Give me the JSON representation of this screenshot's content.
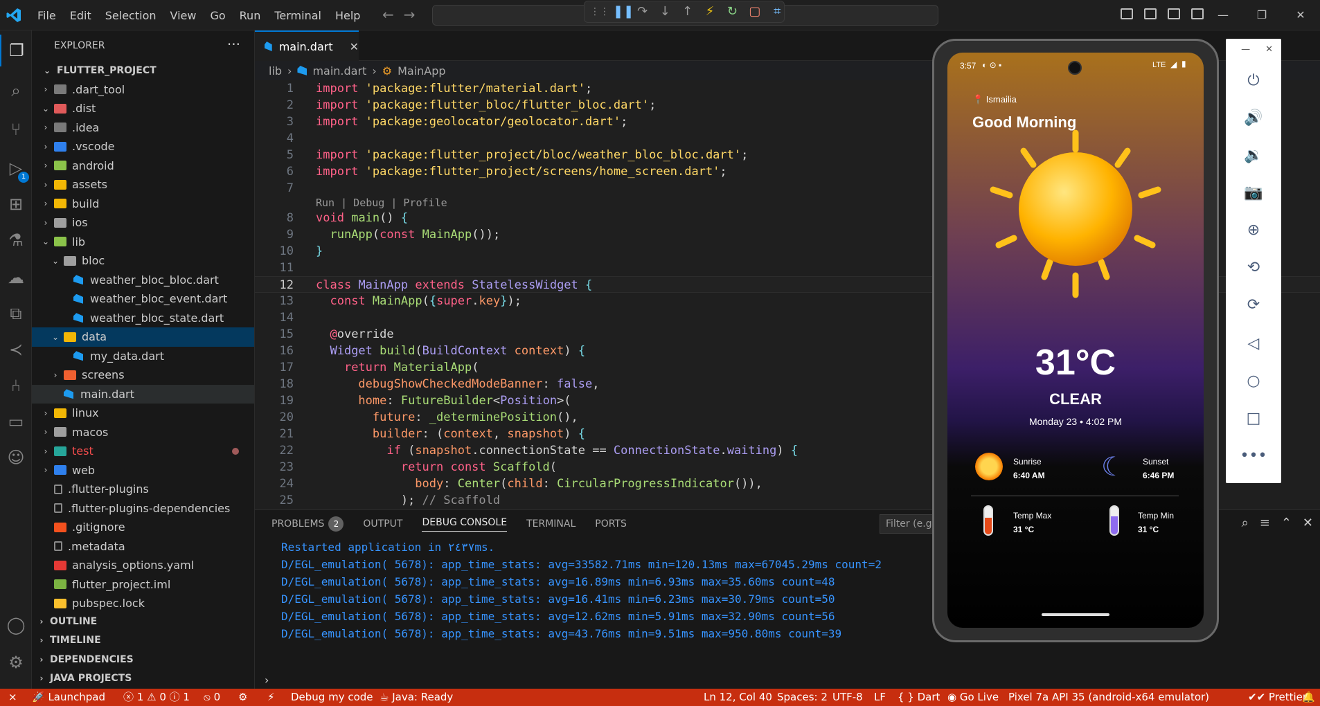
{
  "titlebar": {
    "menu": [
      "File",
      "Edit",
      "Selection",
      "View",
      "Go",
      "Run",
      "Terminal",
      "Help"
    ]
  },
  "activity": {
    "debug_badge": "1"
  },
  "explorer": {
    "title": "EXPLORER",
    "more": "···",
    "project": "FLUTTER_PROJECT",
    "items": [
      {
        "label": ".dart_tool",
        "type": "folder",
        "color": "#7a7a7a"
      },
      {
        "label": ".dist",
        "type": "folder-open",
        "color": "#e05a5a"
      },
      {
        "label": ".idea",
        "type": "folder",
        "color": "#7a7a7a"
      },
      {
        "label": ".vscode",
        "type": "folder",
        "color": "#2f80ed"
      },
      {
        "label": "android",
        "type": "folder",
        "color": "#8bc34a"
      },
      {
        "label": "assets",
        "type": "folder",
        "color": "#f2b705"
      },
      {
        "label": "build",
        "type": "folder",
        "color": "#f2b705"
      },
      {
        "label": "ios",
        "type": "folder",
        "color": "#9e9e9e"
      },
      {
        "label": "lib",
        "type": "folder-open",
        "color": "#8bc34a"
      },
      {
        "label": "bloc",
        "type": "folder-open",
        "color": "#9e9e9e"
      },
      {
        "label": "weather_bloc_bloc.dart",
        "type": "dart"
      },
      {
        "label": "weather_bloc_event.dart",
        "type": "dart"
      },
      {
        "label": "weather_bloc_state.dart",
        "type": "dart"
      },
      {
        "label": "data",
        "type": "folder-open",
        "color": "#f2b705"
      },
      {
        "label": "my_data.dart",
        "type": "dart"
      },
      {
        "label": "screens",
        "type": "folder",
        "color": "#f06030"
      },
      {
        "label": "main.dart",
        "type": "dart"
      },
      {
        "label": "linux",
        "type": "folder",
        "color": "#f2b705"
      },
      {
        "label": "macos",
        "type": "folder",
        "color": "#9e9e9e"
      },
      {
        "label": "test",
        "type": "folder",
        "color": "#26a69a"
      },
      {
        "label": "web",
        "type": "folder",
        "color": "#2f80ed"
      },
      {
        "label": ".flutter-plugins",
        "type": "file"
      },
      {
        "label": ".flutter-plugins-dependencies",
        "type": "file"
      },
      {
        "label": ".gitignore",
        "type": "file-git"
      },
      {
        "label": ".metadata",
        "type": "file"
      },
      {
        "label": "analysis_options.yaml",
        "type": "file-yaml"
      },
      {
        "label": "flutter_project.iml",
        "type": "file-iml"
      },
      {
        "label": "pubspec.lock",
        "type": "file-lock"
      }
    ],
    "sections": [
      "OUTLINE",
      "TIMELINE",
      "DEPENDENCIES",
      "JAVA PROJECTS"
    ]
  },
  "editor": {
    "tab": "main.dart",
    "breadcrumb": [
      "lib",
      "main.dart",
      "MainApp"
    ],
    "codelens": "Run | Debug | Profile"
  },
  "panel": {
    "tabs": [
      "PROBLEMS",
      "OUTPUT",
      "DEBUG CONSOLE",
      "TERMINAL",
      "PORTS"
    ],
    "problems_count": "2",
    "filter_placeholder": "Filter (e.g.",
    "console": [
      "Restarted application in ٢٤٣٧ms.",
      "D/EGL_emulation( 5678): app_time_stats: avg=33582.71ms min=120.13ms max=67045.29ms count=2",
      "D/EGL_emulation( 5678): app_time_stats: avg=16.89ms min=6.93ms max=35.60ms count=48",
      "D/EGL_emulation( 5678): app_time_stats: avg=16.41ms min=6.23ms max=30.79ms count=50",
      "D/EGL_emulation( 5678): app_time_stats: avg=12.62ms min=5.91ms max=32.90ms count=56",
      "D/EGL_emulation( 5678): app_time_stats: avg=43.76ms min=9.51ms max=950.80ms count=39"
    ]
  },
  "status": {
    "launchpad": "Launchpad",
    "errors": "1",
    "warnings": "0",
    "info": "1",
    "ports": "0",
    "debug": "Debug my code",
    "java": "Java: Ready",
    "position": "Ln 12, Col 40",
    "spaces": "Spaces: 2",
    "encoding": "UTF-8",
    "eol": "LF",
    "language": "Dart",
    "golive": "Go Live",
    "device": "Pixel 7a API 35 (android-x64 emulator)",
    "prettier": "Prettier"
  },
  "phone": {
    "time": "3:57",
    "network": "LTE",
    "location": "📍 Ismailia",
    "greeting": "Good Morning",
    "temperature": "31°C",
    "condition": "CLEAR",
    "date": "Monday 23 • 4:02 PM",
    "sunrise_label": "Sunrise",
    "sunrise": "6:40 AM",
    "sunset_label": "Sunset",
    "sunset": "6:46 PM",
    "tmax_label": "Temp Max",
    "tmax": "31 °C",
    "tmin_label": "Temp Min",
    "tmin": "31 °C"
  }
}
